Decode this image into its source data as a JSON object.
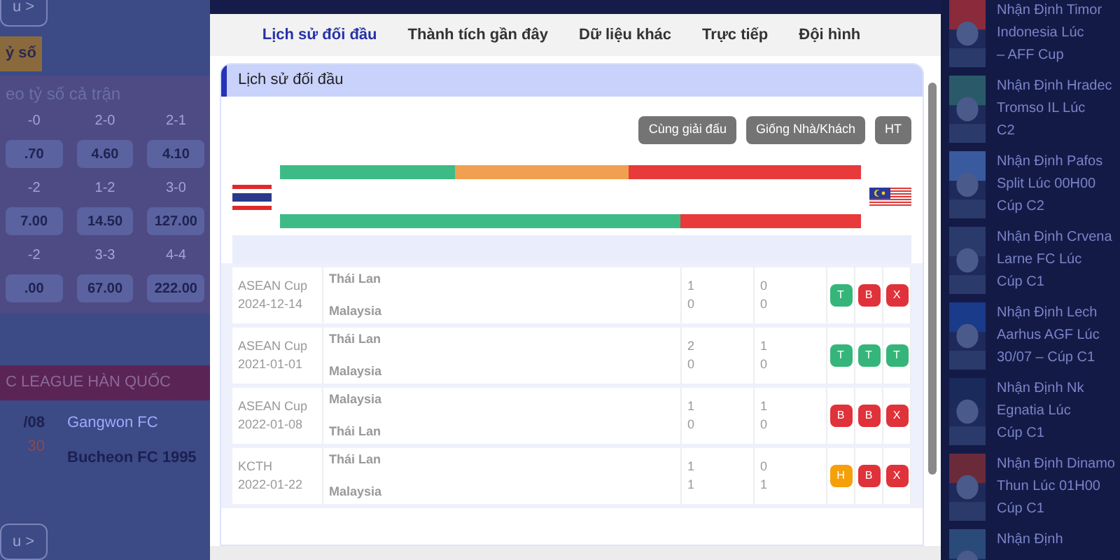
{
  "left_page": {
    "more_button_top": "u >",
    "tab": "ỷ số",
    "odds_title": "eo tỷ số cả trận",
    "odds_rows": [
      {
        "labels": [
          "-0",
          "2-0",
          "2-1"
        ],
        "values": [
          ".70",
          "4.60",
          "4.10"
        ]
      },
      {
        "labels": [
          "-2",
          "1-2",
          "3-0"
        ],
        "values": [
          "7.00",
          "14.50",
          "127.00"
        ]
      },
      {
        "labels": [
          "-2",
          "3-3",
          "4-4"
        ],
        "values": [
          ".00",
          "67.00",
          "222.00"
        ]
      }
    ],
    "league": "C LEAGUE HÀN QUỐC",
    "match": {
      "date": "/08",
      "time": "30",
      "home": "Gangwon FC",
      "away": "Bucheon FC 1995"
    },
    "more_button_bottom": "u >"
  },
  "modal": {
    "tabs": [
      {
        "label": "Lịch sử đối đầu",
        "selected": true
      },
      {
        "label": "Thành tích gần đây",
        "selected": false
      },
      {
        "label": "Dữ liệu khác",
        "selected": false
      },
      {
        "label": "Trực tiếp",
        "selected": false
      },
      {
        "label": "Đội hình",
        "selected": false
      }
    ],
    "section_title": "Lịch sử đối đầu",
    "filters": [
      "Cùng giải đấu",
      "Giống Nhà/Khách",
      "HT"
    ],
    "bars": [
      {
        "color": "#e83a3a",
        "segments": [
          {
            "color": "#3dbb87",
            "level": 0.3
          },
          {
            "color": "#f0a050",
            "level": 0.6
          }
        ]
      },
      {
        "color": "#e83a3a",
        "segments": [
          {
            "color": "#3dbb87",
            "level": 0.69
          }
        ]
      }
    ],
    "rows": [
      {
        "league": "ASEAN Cup",
        "date": "2024-12-14",
        "teams": [
          "Thái Lan",
          "Malaysia"
        ],
        "ft": [
          "1",
          "0"
        ],
        "ht": [
          "0",
          "0"
        ],
        "results": [
          {
            "text": "T",
            "color": "#35b57a"
          },
          {
            "text": "B",
            "color": "#e0323a"
          },
          {
            "text": "X",
            "color": "#e0323a"
          }
        ]
      },
      {
        "league": "ASEAN Cup",
        "date": "2021-01-01",
        "teams": [
          "Thái Lan",
          "Malaysia"
        ],
        "ft": [
          "2",
          "0"
        ],
        "ht": [
          "1",
          "0"
        ],
        "results": [
          {
            "text": "T",
            "color": "#35b57a"
          },
          {
            "text": "T",
            "color": "#35b57a"
          },
          {
            "text": "T",
            "color": "#35b57a"
          }
        ]
      },
      {
        "league": "ASEAN Cup",
        "date": "2022-01-08",
        "teams": [
          "Malaysia",
          "Thái Lan"
        ],
        "ft": [
          "1",
          "0"
        ],
        "ht": [
          "1",
          "0"
        ],
        "results": [
          {
            "text": "B",
            "color": "#e0323a"
          },
          {
            "text": "B",
            "color": "#e0323a"
          },
          {
            "text": "X",
            "color": "#e0323a"
          }
        ]
      },
      {
        "league": "KCTH",
        "date": "2022-01-22",
        "teams": [
          "Thái Lan",
          "Malaysia"
        ],
        "ft": [
          "1",
          "1"
        ],
        "ht": [
          "0",
          "1"
        ],
        "results": [
          {
            "text": "H",
            "color": "#f5a00a"
          },
          {
            "text": "B",
            "color": "#e0323a"
          },
          {
            "text": "X",
            "color": "#e0323a"
          }
        ]
      }
    ]
  },
  "news": [
    {
      "lines": [
        "Nhận Định Timor",
        "Indonesia Lúc",
        "– AFF Cup"
      ]
    },
    {
      "lines": [
        "Nhận Định Hradec",
        "Tromso IL Lúc",
        "C2"
      ]
    },
    {
      "lines": [
        "Nhận Định Pafos",
        "Split Lúc 00H00",
        "Cúp C2"
      ]
    },
    {
      "lines": [
        "Nhận Định Crvena",
        "Larne FC Lúc",
        "Cúp C1"
      ]
    },
    {
      "lines": [
        "Nhận Định Lech",
        "Aarhus AGF Lúc",
        "30/07 – Cúp C1"
      ]
    },
    {
      "lines": [
        "Nhận Định Nk",
        "Egnatia Lúc",
        "Cúp C1"
      ]
    },
    {
      "lines": [
        "Nhận Định Dinamo",
        "Thun Lúc 01H00",
        "Cúp C1"
      ]
    },
    {
      "lines": [
        "Nhận Định"
      ]
    }
  ]
}
